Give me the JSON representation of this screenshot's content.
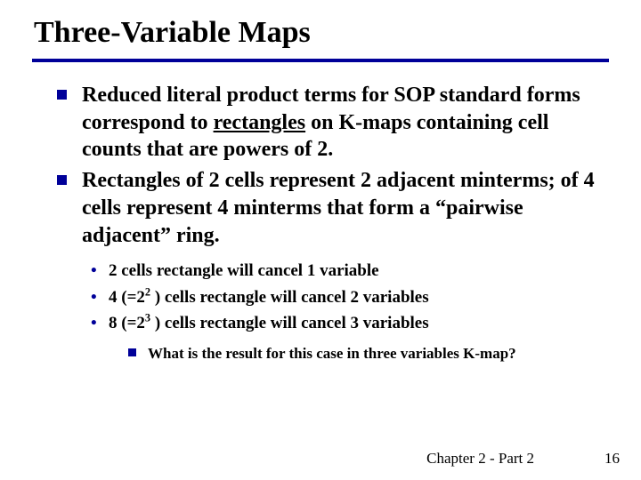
{
  "title": "Three-Variable Maps",
  "main_bullets": [
    {
      "pre": "Reduced literal product terms for SOP standard forms correspond to ",
      "underlined": "rectangles",
      "post": " on K-maps containing cell counts that are powers of 2."
    },
    {
      "text": "Rectangles of 2 cells represent 2 adjacent minterms; of 4 cells represent 4 minterms that form a “pairwise adjacent” ring."
    }
  ],
  "sub_bullets": [
    {
      "text": "2 cells rectangle will cancel 1 variable"
    },
    {
      "pre": "4 (=2",
      "sup": "2",
      "post": " ) cells rectangle will cancel 2 variables"
    },
    {
      "pre": "8 (=2",
      "sup": "3",
      "post": " ) cells rectangle will cancel 3 variables"
    }
  ],
  "sub2_bullets": [
    {
      "text": "What is the result for this case in three variables K-map?"
    }
  ],
  "footer": {
    "center": "Chapter 2 - Part 2",
    "page": "16"
  }
}
